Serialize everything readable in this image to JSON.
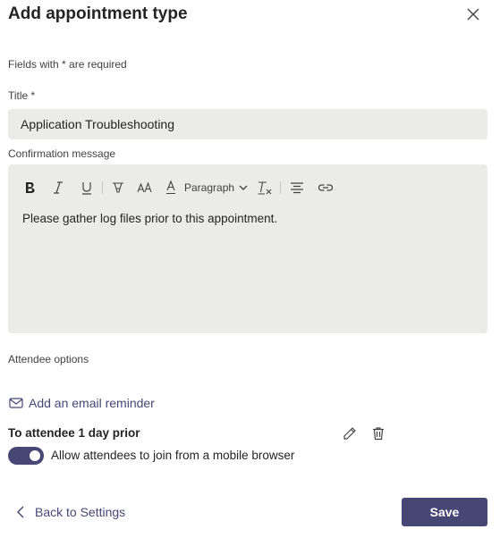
{
  "dialog": {
    "title": "Add appointment type",
    "required_hint": "Fields with * are required"
  },
  "title_field": {
    "label": "Title *",
    "value": "Application Troubleshooting"
  },
  "confirmation": {
    "label": "Confirmation message",
    "paragraph_style": "Paragraph",
    "content": "Please gather log files prior to this appointment."
  },
  "attendee": {
    "section_label": "Attendee options",
    "add_reminder_label": "Add an email reminder",
    "reminder_title": "To attendee 1 day prior",
    "mobile_toggle_label": "Allow attendees to join from a mobile browser",
    "mobile_toggle_on": true
  },
  "footer": {
    "back_label": "Back to Settings",
    "save_label": "Save"
  },
  "colors": {
    "accent": "#464775",
    "field_bg": "#ebebea",
    "text": "#242424"
  },
  "icons": [
    "close-icon",
    "bold-icon",
    "italic-icon",
    "underline-icon",
    "highlight-icon",
    "font-size-icon",
    "font-color-icon",
    "chevron-down-icon",
    "clear-formatting-icon",
    "align-center-icon",
    "link-icon",
    "mail-icon",
    "pencil-icon",
    "trash-icon",
    "chevron-left-icon"
  ]
}
